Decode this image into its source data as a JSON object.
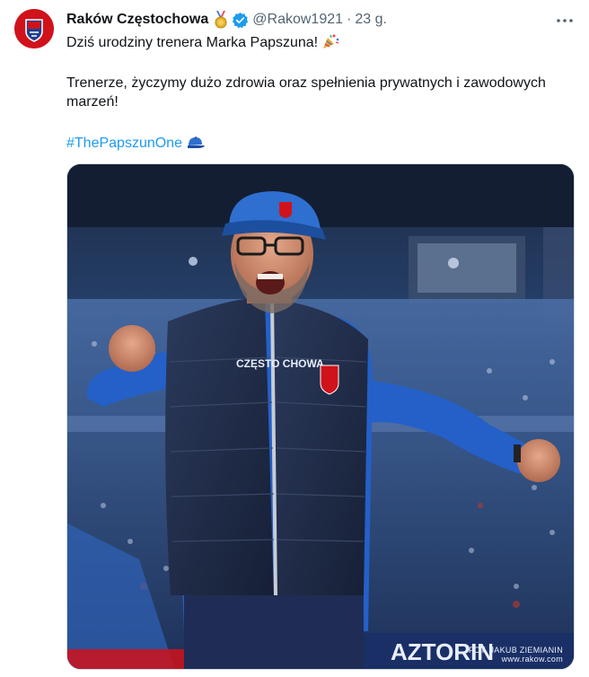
{
  "author": {
    "name": "Raków Częstochowa",
    "handle": "@Rakow1921",
    "separator": "·",
    "time": "23 g."
  },
  "icons": {
    "avatar": "club-crest-logo",
    "medal": "medal-icon",
    "verified": "verified-badge-icon",
    "more": "more-options-icon",
    "party": "party-popper-icon",
    "cap": "blue-cap-icon"
  },
  "tweet": {
    "line1": "Dziś urodziny trenera Marka Papszuna!",
    "line2": "Trenerze, życzymy dużo zdrowia oraz spełnienia prywatnych i zawodowych marzeń!",
    "hashtag": "#ThePapszunOne"
  },
  "media": {
    "jacket_text": "CZĘSTO CHOWA",
    "sponsor_text": "AZTORIN",
    "credit_line1": "FOT. JAKUB ZIEMIANIN",
    "credit_line2": "www.rakow.com"
  },
  "colors": {
    "accent": "#1d9bf0",
    "club_red": "#d0121b",
    "text": "#0f1419",
    "muted": "#536471"
  }
}
